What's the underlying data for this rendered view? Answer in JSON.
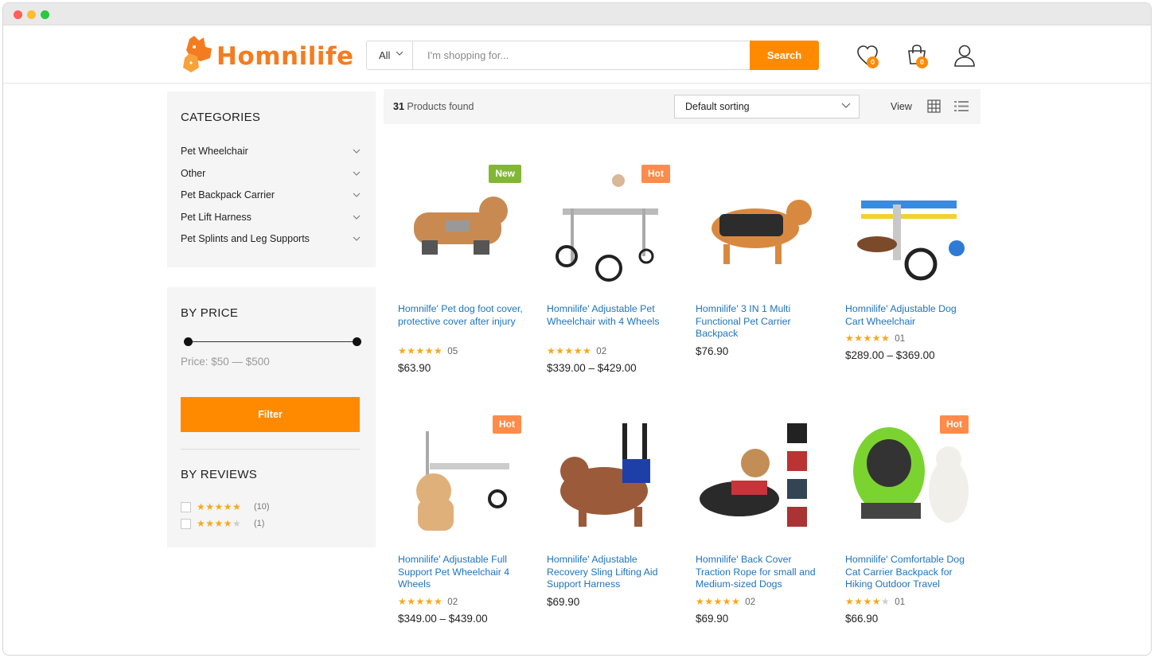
{
  "colors": {
    "accent": "#ff8a00",
    "link": "#1e73be",
    "new_badge": "#82b735",
    "hot_badge": "#ff8b4a",
    "star": "#f9a71c"
  },
  "header": {
    "logo_text": "Homnilife",
    "search": {
      "category": "All",
      "placeholder": "I'm shopping for...",
      "button": "Search"
    },
    "wishlist_count": "0",
    "cart_count": "0"
  },
  "sidebar": {
    "categories_title": "CATEGORIES",
    "categories": [
      "Pet Wheelchair",
      "Other",
      "Pet Backpack Carrier",
      "Pet Lift Harness",
      "Pet Splints and Leg Supports"
    ],
    "price_title": "BY PRICE",
    "price_range": {
      "min": 50,
      "max": 500
    },
    "price_label": "Price: $50 — $500",
    "filter_button": "Filter",
    "reviews_title": "BY REVIEWS",
    "reviews": [
      {
        "stars": 5,
        "count": "(10)"
      },
      {
        "stars": 4,
        "count": "(1)"
      }
    ]
  },
  "toolbar": {
    "found_count": "31",
    "found_text": "Products found",
    "sort_value": "Default sorting",
    "view_label": "View"
  },
  "products": [
    {
      "title": "Homnilfe' Pet dog foot cover, protective cover after injury",
      "badge": "New",
      "rating": 5,
      "reviews": "05",
      "price": "$63.90"
    },
    {
      "title": "Homnilife' Adjustable Pet Wheelchair with 4 Wheels",
      "badge": "Hot",
      "rating": 5,
      "reviews": "02",
      "price": "$339.00 – $429.00"
    },
    {
      "title": "Homnilife' 3 IN 1 Multi Functional Pet Carrier Backpack",
      "badge": "",
      "rating": 0,
      "reviews": "",
      "price": "$76.90"
    },
    {
      "title": "Homnilife' Adjustable Dog Cart Wheelchair",
      "badge": "",
      "rating": 5,
      "reviews": "01",
      "price": "$289.00 – $369.00"
    },
    {
      "title": "Homnilife' Adjustable Full Support Pet Wheelchair 4 Wheels",
      "badge": "Hot",
      "rating": 5,
      "reviews": "02",
      "price": "$349.00 – $439.00"
    },
    {
      "title": "Homnilife' Adjustable Recovery Sling Lifting Aid Support Harness",
      "badge": "",
      "rating": 0,
      "reviews": "",
      "price": "$69.90"
    },
    {
      "title": "Homnilife' Back Cover Traction Rope for small and Medium-sized Dogs",
      "badge": "",
      "rating": 5,
      "reviews": "02",
      "price": "$69.90"
    },
    {
      "title": "Homnilife' Comfortable Dog Cat Carrier Backpack for Hiking Outdoor Travel",
      "badge": "Hot",
      "rating": 4,
      "reviews": "01",
      "price": "$66.90"
    }
  ],
  "icons": [
    "heart-icon",
    "cart-icon",
    "user-icon",
    "chevron-down-icon",
    "grid-view-icon",
    "list-view-icon"
  ]
}
